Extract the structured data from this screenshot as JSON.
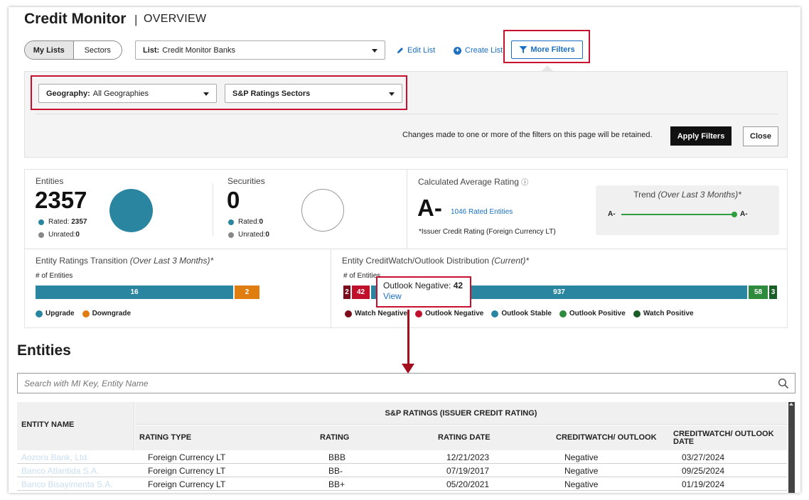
{
  "header": {
    "title": "Credit Monitor",
    "separator": "|",
    "subtitle": "OVERVIEW"
  },
  "list_toggle": {
    "options": [
      "My Lists",
      "Sectors"
    ],
    "active": "My Lists"
  },
  "list_select": {
    "label": "List:",
    "value": "Credit Monitor Banks"
  },
  "actions": {
    "edit_list": "Edit List",
    "create_list": "Create List",
    "more_filters": "More Filters"
  },
  "filters": {
    "geography": {
      "label": "Geography:",
      "value": "All Geographies"
    },
    "sector": {
      "value": "S&P Ratings Sectors"
    },
    "note": "Changes made to one or more of the filters on this page will be retained.",
    "apply_label": "Apply Filters",
    "close_label": "Close"
  },
  "entities_stat": {
    "label": "Entities",
    "count": "2357",
    "rated_label": "Rated:",
    "rated": "2357",
    "unrated_label": "Unrated:",
    "unrated": "0",
    "color": "#2a86a0"
  },
  "securities_stat": {
    "label": "Securities",
    "count": "0",
    "rated_label": "Rated:",
    "rated": "0",
    "unrated_label": "Unrated:",
    "unrated": "0"
  },
  "avg_rating": {
    "label": "Calculated Average Rating",
    "value": "A-",
    "rated_link": "1046 Rated Entities",
    "note": "*Issuer Credit Rating (Foreign Currency LT)"
  },
  "trend": {
    "title": "Trend",
    "title_em": "(Over Last 3 Months)*",
    "start": "A-",
    "end": "A-"
  },
  "transition": {
    "title": "Entity Ratings Transition",
    "title_em": "(Over Last 3 Months)*",
    "axis": "# of Entities",
    "bars": [
      {
        "name": "Upgrade",
        "value": "16",
        "color": "#2a86a0"
      },
      {
        "name": "Downgrade",
        "value": "2",
        "color": "#e07d10"
      }
    ],
    "legend": [
      "Upgrade",
      "Downgrade"
    ]
  },
  "distribution": {
    "title": "Entity CreditWatch/Outlook Distribution",
    "title_em": "(Current)*",
    "axis": "# of Entities",
    "bars": [
      {
        "name": "Watch Negative",
        "value": "2",
        "color": "#7a0c1b"
      },
      {
        "name": "Outlook Negative",
        "value": "42",
        "color": "#c0102c"
      },
      {
        "name": "Outlook Stable",
        "value": "937",
        "color": "#2a86a0"
      },
      {
        "name": "Outlook Positive",
        "value": "58",
        "color": "#2e8b3e"
      },
      {
        "name": "Watch Positive",
        "value": "3",
        "color": "#1a5e27"
      }
    ],
    "legend": [
      "Watch Negative",
      "Outlook Negative",
      "Outlook Stable",
      "Outlook Positive",
      "Watch Positive"
    ]
  },
  "tooltip": {
    "label": "Outlook Negative:",
    "value": "42",
    "link": "View"
  },
  "entities_section": {
    "title": "Entities",
    "search_placeholder": "Search with MI Key, Entity Name"
  },
  "table": {
    "entity_header": "ENTITY NAME",
    "group_header": "S&P RATINGS (ISSUER CREDIT RATING)",
    "columns": [
      "RATING TYPE",
      "RATING",
      "RATING DATE",
      "CREDITWATCH/ OUTLOOK",
      "CREDITWATCH/ OUTLOOK DATE"
    ],
    "rows": [
      {
        "name": "Aozora Bank, Ltd.",
        "type": "Foreign Currency LT",
        "rating": "BBB",
        "date": "12/21/2023",
        "outlook": "Negative",
        "outlook_date": "03/27/2024"
      },
      {
        "name": "Banco Atlantida S.A.",
        "type": "Foreign Currency LT",
        "rating": "BB-",
        "date": "07/19/2017",
        "outlook": "Negative",
        "outlook_date": "09/25/2024"
      },
      {
        "name": "Banco Bisayimenta S.A.",
        "type": "Foreign Currency LT",
        "rating": "BB+",
        "date": "05/20/2021",
        "outlook": "Negative",
        "outlook_date": "01/19/2024"
      }
    ]
  }
}
